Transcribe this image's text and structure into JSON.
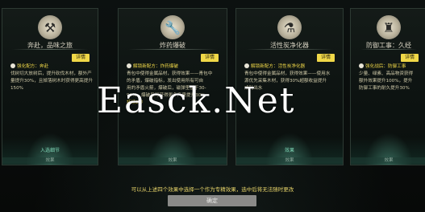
{
  "cards": [
    {
      "icon": "hammer-icon",
      "title": "奔赴，品味之旅",
      "detail": "详情",
      "lines": [
        "强化配方：奔赴",
        "伐树切大放树后，提升砍伐木材，额外产",
        "量提升30%，且掉落树木时获得更高提升",
        "150%"
      ],
      "tag": "入选细节",
      "caption": "效果"
    },
    {
      "icon": "wrench-icon",
      "title": "炸药爆破",
      "detail": "详情",
      "lines": [
        "解锁新配方：炸药爆破",
        "青包中使得金属品材，获得效果——青包中",
        "的矛盾，爆破指标，发出使用所有可自",
        "用的矛盾火箭，爆破后，磁弹里基于30-",
        "90%，爆破后可获得更多产量提升30%",
        "持续2秒"
      ],
      "tag": "",
      "caption": "效果"
    },
    {
      "icon": "flask-icon",
      "title": "活性炭净化器",
      "detail": "详情",
      "lines": [
        "解锁新配方：活性炭净化器",
        "青包中使得金属品材，获得效果——使用水",
        "源优先采集木材，获得30%超额收益提升",
        "成耗出水"
      ],
      "tag": "效果",
      "caption": "效果"
    },
    {
      "icon": "tower-icon",
      "title": "防御工事：久经",
      "detail": "详情",
      "lines": [
        "强化战后：防御工事",
        "少量、绿素、高品物资获得",
        "额外效果提升100%，提升",
        "防御工事的耐久提升30%"
      ],
      "tag": "",
      "caption": "效果"
    }
  ],
  "watermark": "Easck.Net",
  "hint": "可以从上述四个效果中选择一个作为专精效果，选中后将无法随时更改",
  "confirm": "确定"
}
